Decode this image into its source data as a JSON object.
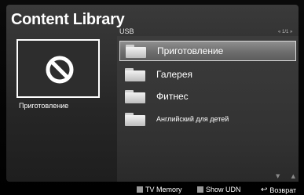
{
  "header": {
    "title": "Content Library"
  },
  "preview": {
    "icon": "prohibited-icon",
    "label": "Приготовление"
  },
  "browser": {
    "source": "USB",
    "pager": "« 1/1 »",
    "items": [
      {
        "label": "Приготовление",
        "icon": "folder-icon",
        "selected": true
      },
      {
        "label": "Галерея",
        "icon": "folder-icon",
        "selected": false
      },
      {
        "label": "Фитнес",
        "icon": "folder-icon",
        "selected": false
      },
      {
        "label": "Английский для детей",
        "icon": "folder-icon",
        "selected": false
      }
    ],
    "scroll_indicator": "▼ ▲"
  },
  "footer": {
    "tv_memory": "TV Memory",
    "show_udn": "Show UDN",
    "return": "Возврат",
    "return_icon": "↩"
  },
  "colors": {
    "selected_highlight": "#7a7a7a",
    "panel_background": "#333333",
    "text": "#ffffff"
  }
}
